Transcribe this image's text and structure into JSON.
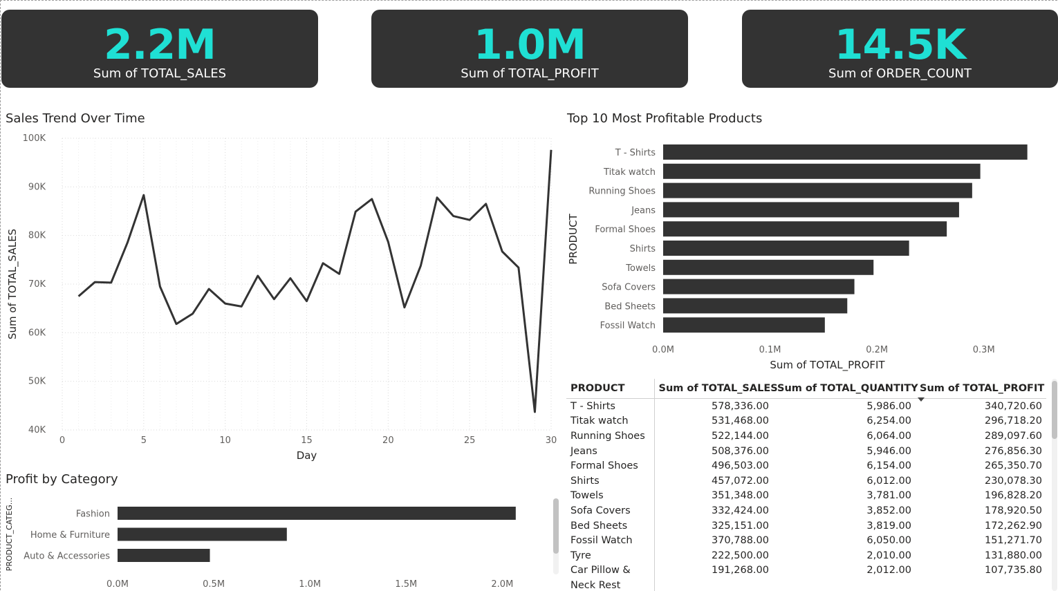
{
  "kpis": [
    {
      "value": "2.2M",
      "label": "Sum of TOTAL_SALES"
    },
    {
      "value": "1.0M",
      "label": "Sum of TOTAL_PROFIT"
    },
    {
      "value": "14.5K",
      "label": "Sum of ORDER_COUNT"
    }
  ],
  "colors": {
    "accent": "#1fe0d4",
    "card_bg": "#333333",
    "bar": "#333333",
    "line": "#333333"
  },
  "sales_trend": {
    "title": "Sales Trend Over Time",
    "chart_data": {
      "type": "line",
      "title": "Sales Trend Over Time",
      "xlabel": "Day",
      "ylabel": "Sum of TOTAL_SALES",
      "x": [
        1,
        2,
        3,
        4,
        5,
        6,
        7,
        8,
        9,
        10,
        11,
        12,
        13,
        14,
        15,
        16,
        17,
        18,
        19,
        20,
        21,
        22,
        23,
        24,
        25,
        26,
        27,
        28,
        29,
        30
      ],
      "y": [
        67500,
        70400,
        70300,
        78500,
        88300,
        69500,
        61800,
        63900,
        69000,
        66000,
        65400,
        71700,
        66900,
        71200,
        66500,
        74300,
        72100,
        84900,
        87500,
        78700,
        65200,
        73800,
        87800,
        84000,
        83200,
        86500,
        76700,
        73400,
        43700,
        97600
      ],
      "xlim": [
        0,
        30
      ],
      "ylim": [
        40000,
        100000
      ],
      "xticks": [
        "0",
        "5",
        "10",
        "15",
        "20",
        "25",
        "30"
      ],
      "yticks": [
        "40K",
        "50K",
        "60K",
        "70K",
        "80K",
        "90K",
        "100K"
      ],
      "grid": true
    }
  },
  "top_products": {
    "title": "Top 10 Most Profitable Products",
    "chart_data": {
      "type": "bar",
      "orientation": "horizontal",
      "title": "Top 10 Most Profitable Products",
      "xlabel": "Sum of TOTAL_PROFIT",
      "ylabel": "PRODUCT",
      "categories": [
        "T - Shirts",
        "Titak watch",
        "Running Shoes",
        "Jeans",
        "Formal Shoes",
        "Shirts",
        "Towels",
        "Sofa Covers",
        "Bed Sheets",
        "Fossil Watch"
      ],
      "values": [
        340720.6,
        296718.2,
        289097.6,
        276856.3,
        265350.7,
        230078.3,
        196828.2,
        178920.5,
        172262.9,
        151271.7
      ],
      "xlim": [
        0,
        350000
      ],
      "xticks": [
        "0.0M",
        "0.1M",
        "0.2M",
        "0.3M"
      ]
    }
  },
  "profit_by_category": {
    "title": "Profit by Category",
    "chart_data": {
      "type": "bar",
      "orientation": "horizontal",
      "title": "Profit by Category",
      "ylabel": "PRODUCT_CATEG...",
      "categories": [
        "Fashion",
        "Home & Furniture",
        "Auto & Accessories"
      ],
      "values": [
        2070000,
        880000,
        480000
      ],
      "xlim": [
        0,
        2200000
      ],
      "xticks": [
        "0.0M",
        "0.5M",
        "1.0M",
        "1.5M",
        "2.0M"
      ]
    }
  },
  "table": {
    "columns": [
      "PRODUCT",
      "Sum of TOTAL_SALES",
      "Sum of TOTAL_QUANTITY",
      "Sum of TOTAL_PROFIT"
    ],
    "rows": [
      [
        "T - Shirts",
        "578,336.00",
        "5,986.00",
        "340,720.60"
      ],
      [
        "Titak watch",
        "531,468.00",
        "6,254.00",
        "296,718.20"
      ],
      [
        "Running Shoes",
        "522,144.00",
        "6,064.00",
        "289,097.60"
      ],
      [
        "Jeans",
        "508,376.00",
        "5,946.00",
        "276,856.30"
      ],
      [
        "Formal Shoes",
        "496,503.00",
        "6,154.00",
        "265,350.70"
      ],
      [
        "Shirts",
        "457,072.00",
        "6,012.00",
        "230,078.30"
      ],
      [
        "Towels",
        "351,348.00",
        "3,781.00",
        "196,828.20"
      ],
      [
        "Sofa Covers",
        "332,424.00",
        "3,852.00",
        "178,920.50"
      ],
      [
        "Bed Sheets",
        "325,151.00",
        "3,819.00",
        "172,262.90"
      ],
      [
        "Fossil Watch",
        "370,788.00",
        "6,050.00",
        "151,271.70"
      ],
      [
        "Tyre",
        "222,500.00",
        "2,010.00",
        "131,880.00"
      ],
      [
        "Car Pillow &",
        "191,268.00",
        "2,012.00",
        "107,735.80"
      ],
      [
        "Neck Rest",
        "",
        "",
        ""
      ]
    ]
  }
}
